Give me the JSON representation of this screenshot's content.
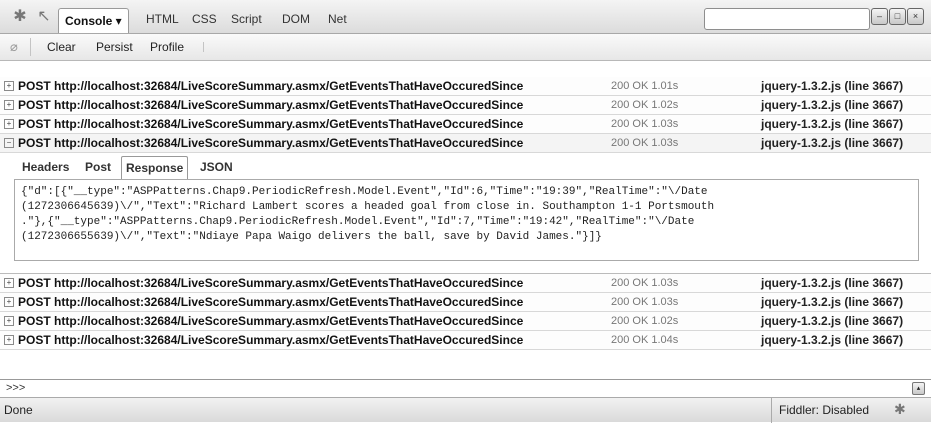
{
  "toolbar": {
    "tabs": [
      {
        "label": "Console ▾",
        "active": true
      },
      {
        "label": "HTML"
      },
      {
        "label": "CSS"
      },
      {
        "label": "Script"
      },
      {
        "label": "DOM"
      },
      {
        "label": "Net"
      }
    ],
    "search_placeholder": "",
    "window_buttons": [
      "–",
      "□",
      "×"
    ]
  },
  "console_toolbar": {
    "clear": "Clear",
    "persist": "Persist",
    "profile": "Profile"
  },
  "requests": [
    {
      "method_url": "POST http://localhost:32684/LiveScoreSummary.asmx/GetEventsThatHaveOccuredSince",
      "status": "200 OK 1.01s",
      "source": "jquery-1.3.2.js (line 3667)",
      "expanded": false
    },
    {
      "method_url": "POST http://localhost:32684/LiveScoreSummary.asmx/GetEventsThatHaveOccuredSince",
      "status": "200 OK 1.02s",
      "source": "jquery-1.3.2.js (line 3667)",
      "expanded": false
    },
    {
      "method_url": "POST http://localhost:32684/LiveScoreSummary.asmx/GetEventsThatHaveOccuredSince",
      "status": "200 OK 1.03s",
      "source": "jquery-1.3.2.js (line 3667)",
      "expanded": false
    },
    {
      "method_url": "POST http://localhost:32684/LiveScoreSummary.asmx/GetEventsThatHaveOccuredSince",
      "status": "200 OK 1.03s",
      "source": "jquery-1.3.2.js (line 3667)",
      "expanded": true
    },
    {
      "method_url": "POST http://localhost:32684/LiveScoreSummary.asmx/GetEventsThatHaveOccuredSince",
      "status": "200 OK 1.03s",
      "source": "jquery-1.3.2.js (line 3667)",
      "expanded": false
    },
    {
      "method_url": "POST http://localhost:32684/LiveScoreSummary.asmx/GetEventsThatHaveOccuredSince",
      "status": "200 OK 1.03s",
      "source": "jquery-1.3.2.js (line 3667)",
      "expanded": false
    },
    {
      "method_url": "POST http://localhost:32684/LiveScoreSummary.asmx/GetEventsThatHaveOccuredSince",
      "status": "200 OK 1.02s",
      "source": "jquery-1.3.2.js (line 3667)",
      "expanded": false
    },
    {
      "method_url": "POST http://localhost:32684/LiveScoreSummary.asmx/GetEventsThatHaveOccuredSince",
      "status": "200 OK 1.04s",
      "source": "jquery-1.3.2.js (line 3667)",
      "expanded": false
    }
  ],
  "detail": {
    "tabs": [
      "Headers",
      "Post",
      "Response",
      "JSON"
    ],
    "active_tab": "Response",
    "response_lines": [
      "{\"d\":[{\"__type\":\"ASPPatterns.Chap9.PeriodicRefresh.Model.Event\",\"Id\":6,\"Time\":\"19:39\",\"RealTime\":\"\\/Date",
      "(1272306645639)\\/\",\"Text\":\"Richard Lambert scores a headed goal from close in. Southampton 1-1 Portsmouth",
      ".\"},{\"__type\":\"ASPPatterns.Chap9.PeriodicRefresh.Model.Event\",\"Id\":7,\"Time\":\"19:42\",\"RealTime\":\"\\/Date",
      "(1272306655639)\\/\",\"Text\":\"Ndiaye Papa Waigo delivers the ball, save by David James.\"}]}"
    ]
  },
  "command_line": {
    "prompt": ">>>"
  },
  "statusbar": {
    "status": "Done",
    "fiddler": "Fiddler: Disabled"
  },
  "icons": {
    "firebug": "bug-icon",
    "inspect": "inspect-icon",
    "console_clear": "clear-icon",
    "fiddler": "fiddler-icon"
  }
}
